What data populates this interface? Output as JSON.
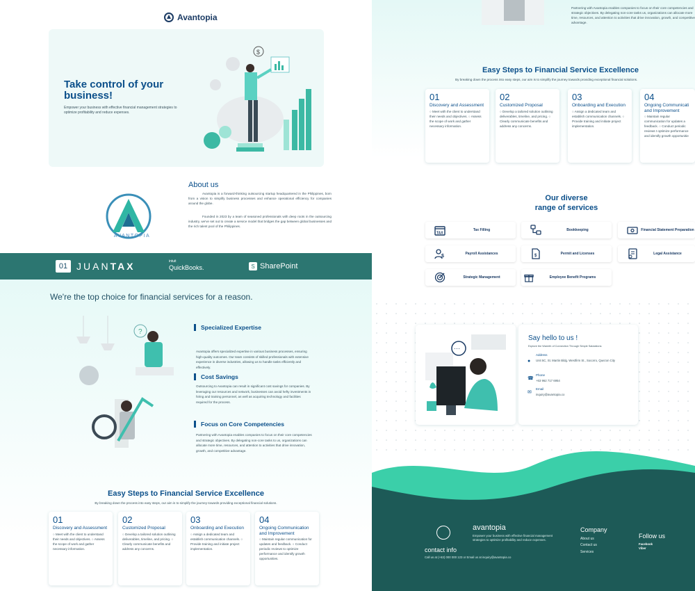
{
  "brand": {
    "name": "Avantopia"
  },
  "hero": {
    "title": "Take control of your business!",
    "subtitle": "Empower your business with effective financial management strategies to optimize profitability and reduce expenses."
  },
  "about": {
    "logo_text": "AVANTOPIA",
    "title": "About us",
    "paragraph1": "Avantopia is a forward-thinking outsourcing startup headquartered in the Philippines, born from a vision to simplify business processes and enhance operational efficiency for companies around the globe.",
    "paragraph2": "Founded in 2023 by a team of seasoned professionals with deep roots in the outsourcing industry, we've set out to create a service model that bridges the gap between global businesses and the rich talent pool of the Philippines."
  },
  "partners": {
    "juantax_num": "01",
    "juantax_a": "JUAN",
    "juantax_b": "TAX",
    "qb_top": "intuit",
    "qb_name": "QuickBooks.",
    "sharepoint": "SharePoint"
  },
  "choice": {
    "title": "We're the top choice for financial services for a reason.",
    "features": [
      {
        "title": "Specialized Expertise",
        "text": "Avantopia offers specialized expertise in various business processes, ensuring high-quality outcomes. Our team consists of skilled professionals with extensive experience in diverse industries, allowing us to handle tasks efficiently and effectively."
      },
      {
        "title": "Cost Savings",
        "text": "Outsourcing to Avantopia can result in significant cost savings for companies. By leveraging our resources and network, businesses can avoid hefty investments in hiring and training personnel, as well as acquiring technology and facilities required for the process."
      },
      {
        "title": "Focus on Core Competencies",
        "text": "Partnering with Avantopia enables companies to focus on their core competencies and strategic objectives. By delegating non-core tasks to us, organizations can allocate more time, resources, and attention to activities that drive innovation, growth, and competitive advantage."
      }
    ]
  },
  "steps": {
    "title": "Easy Steps to Financial Service Excellence",
    "subtitle": "By breaking down the process into easy steps, our aim is to simplify the journey towards providing exceptional financial solutions.",
    "items": [
      {
        "num": "01",
        "name": "Discovery and Assessment",
        "desc": "○ Meet with the client to understand their needs and objectives. ○ Assess the scope of work and gather necessary information."
      },
      {
        "num": "02",
        "name": "Customized Proposal",
        "desc": "○ Develop a tailored solution outlining deliverables, timeline, and pricing. ○ Clearly communicate benefits and address any concerns."
      },
      {
        "num": "03",
        "name": "Onboarding and Execution",
        "desc": "○ Assign a dedicated team and establish communication channels. ○ Provide training and initiate project implementation."
      },
      {
        "num": "04",
        "name": "Ongoing Communication and Improvement",
        "desc": "○ Maintain regular communication for updates and feedback. ○ Conduct periodic reviews to optimize performance and identify growth opportunities."
      }
    ],
    "right_items": [
      {
        "num": "01",
        "name": "Discovery and Assessment"
      },
      {
        "num": "02",
        "name": "Customized Proposal"
      },
      {
        "num": "03",
        "name": "Onboarding and Execution"
      },
      {
        "num": "04",
        "name": "Ongoing Communicati and Improvement"
      }
    ],
    "right_desc": [
      "○ Meet with the client to understand their needs and objectives. ○ Assess the scope of work and gather necessary information.",
      "○ Develop a tailored solution outlining deliverables, timeline, and pricing. ○ Clearly communicate benefits and address any concerns.",
      "○ Assign a dedicated team and establish communication channels. ○ Provide training and initiate project implementation.",
      "○ Maintain regular communication for updates a feedback. ○ Conduct periodic reviews t optimize performance and identify growth opportunitie"
    ]
  },
  "right_partnering": "Partnering with Avantopia enables companies to focus on their core competencies and strategic objectives. By delegating non-core tasks us, organizations can allocate more time, resources, and attention to activities that drive innovation, growth, and competitive advantage.",
  "services": {
    "title_line1": "Our diverse",
    "title_line2": "range of services",
    "items": [
      {
        "label": "Tax Filling",
        "icon": "tax-icon"
      },
      {
        "label": "Bookkeeping",
        "icon": "hierarchy-icon"
      },
      {
        "label": "Financial Statement Preparation",
        "icon": "money-icon"
      },
      {
        "label": "Payroll Assistances",
        "icon": "person-dollar-icon"
      },
      {
        "label": "Permit and Licenses",
        "icon": "document-icon"
      },
      {
        "label": "Legal Assistance",
        "icon": "legal-doc-icon"
      },
      {
        "label": "Strategic Management",
        "icon": "target-icon"
      },
      {
        "label": "Employee Benefit Programs",
        "icon": "gift-icon"
      }
    ]
  },
  "contact": {
    "title": "Say hello to us !",
    "subtitle": "Explore the Warmth of Connection Through Simple Salutations",
    "address_label": "Address",
    "address": "Unit 5C, St. Martin Bldg. Westfirm St., Socorro, Quezon City",
    "phone_label": "Phone",
    "phone": "+63 962 717 6954",
    "email_label": "Email",
    "email": "inquiry@avantopia.co"
  },
  "footer": {
    "brand": "avantopia",
    "desc": "Empower your business with effective financial management strategies to optimize profitability and reduce expenses.",
    "contact_title": "contact info",
    "contact_line": "Call us at (+63) 000 000 123 or Email us at inquiry@avantopia.co",
    "company_title": "Company",
    "links": [
      "About us",
      "Contact us",
      "Services"
    ],
    "follow_title": "Follow us",
    "social": [
      "Facebook",
      "Viber"
    ]
  },
  "colors": {
    "navy": "#0b4f8a",
    "teal": "#2c7671",
    "dark_teal": "#1d5a57",
    "mint": "#3dd6b6"
  }
}
